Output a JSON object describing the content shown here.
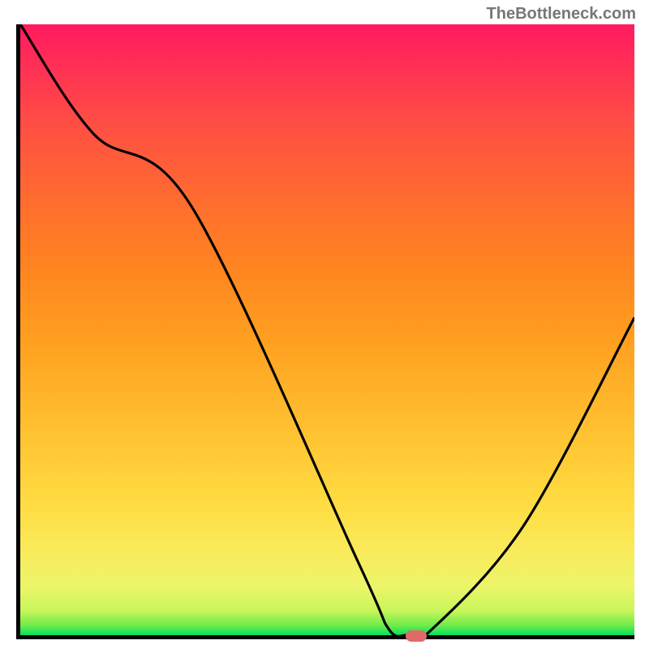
{
  "watermark": "TheBottleneck.com",
  "chart_data": {
    "type": "line",
    "title": "",
    "xlabel": "",
    "ylabel": "",
    "x_range": [
      0,
      100
    ],
    "y_range": [
      0,
      100
    ],
    "series": [
      {
        "name": "curve",
        "x": [
          0,
          12,
          28,
          55,
          60,
          63,
          66,
          82,
          100
        ],
        "y": [
          100,
          82,
          70,
          12,
          1,
          0,
          0,
          18,
          52
        ]
      }
    ],
    "marker": {
      "x": 64,
      "y": 0.5
    },
    "gradient_stops": [
      {
        "pct": 0,
        "color": "#00e060"
      },
      {
        "pct": 1.5,
        "color": "#6aeb4a"
      },
      {
        "pct": 4,
        "color": "#c8f55a"
      },
      {
        "pct": 8,
        "color": "#ecf56a"
      },
      {
        "pct": 14,
        "color": "#f9ea5a"
      },
      {
        "pct": 22,
        "color": "#ffdb40"
      },
      {
        "pct": 34,
        "color": "#ffc030"
      },
      {
        "pct": 48,
        "color": "#ffa020"
      },
      {
        "pct": 60,
        "color": "#ff8520"
      },
      {
        "pct": 72,
        "color": "#ff6a30"
      },
      {
        "pct": 84,
        "color": "#ff4d45"
      },
      {
        "pct": 95,
        "color": "#ff2a58"
      },
      {
        "pct": 100,
        "color": "#ff1a60"
      }
    ]
  }
}
